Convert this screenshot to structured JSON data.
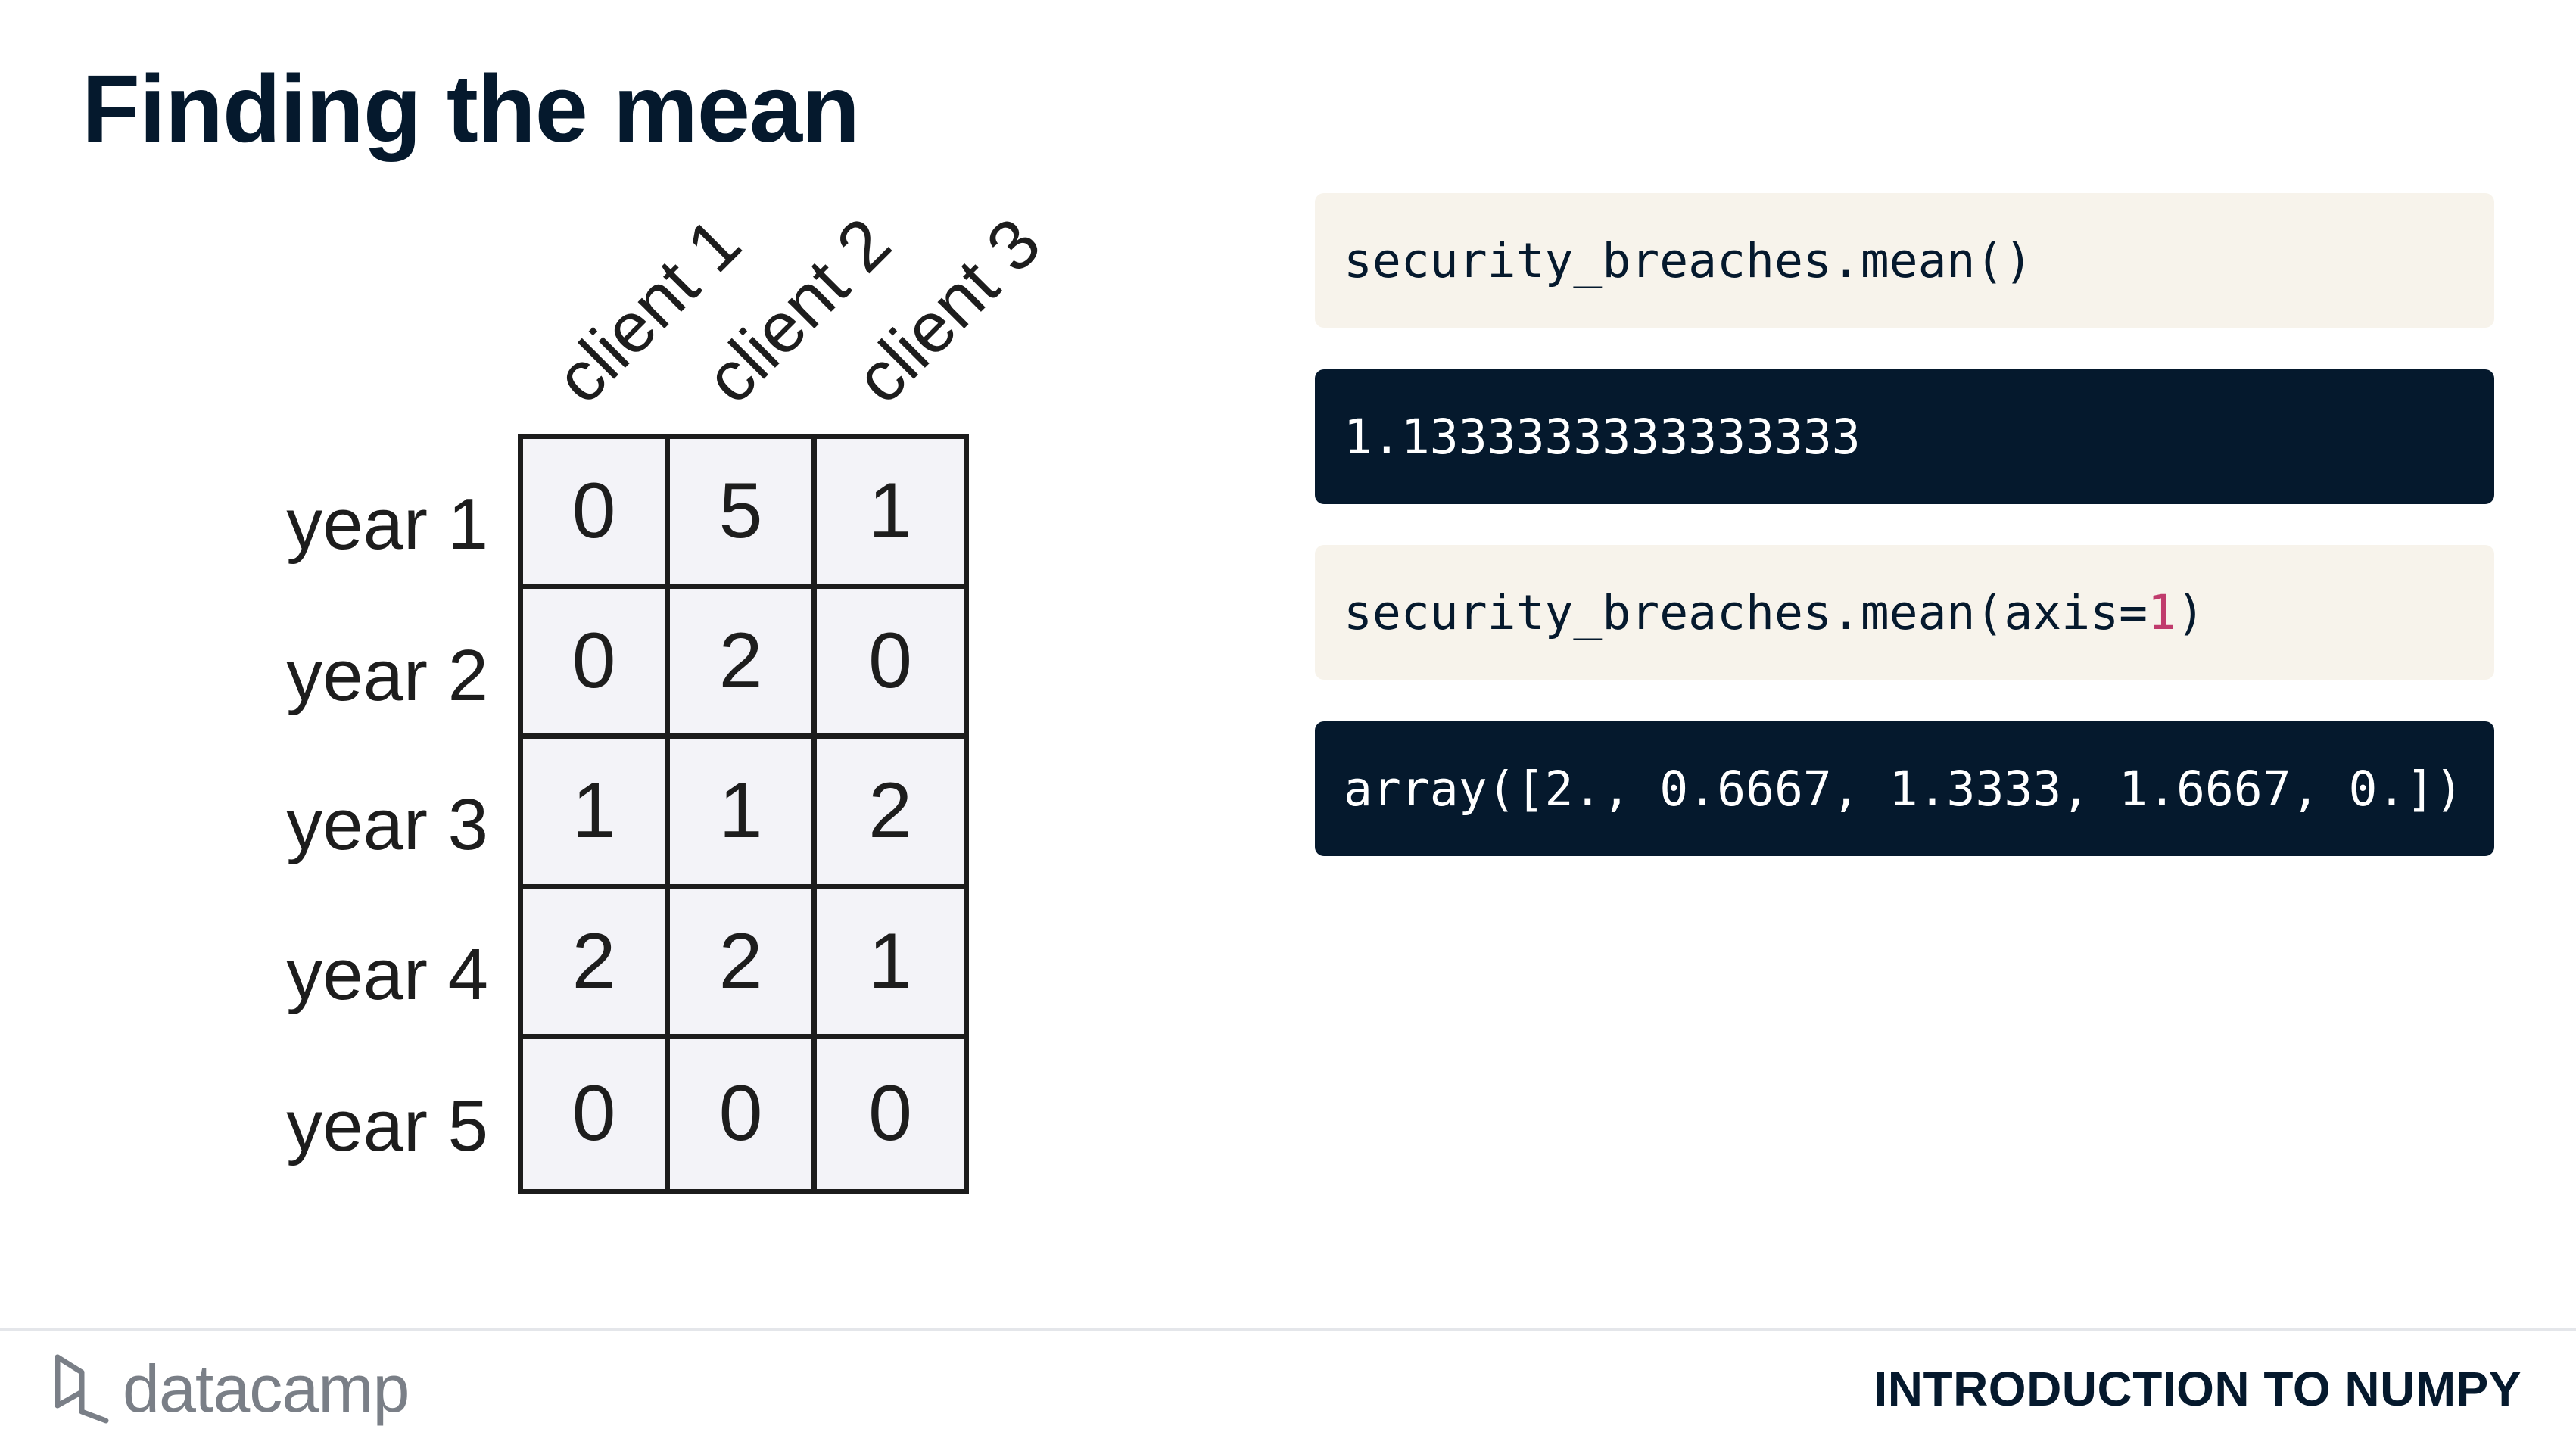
{
  "slide": {
    "title": "Finding the mean",
    "course": "INTRODUCTION TO NUMPY",
    "brand": "datacamp"
  },
  "diagram": {
    "column_labels": [
      "client 1",
      "client 2",
      "client 3"
    ],
    "row_labels": [
      "year 1",
      "year 2",
      "year 3",
      "year 4",
      "year 5"
    ],
    "values": [
      [
        "0",
        "5",
        "1"
      ],
      [
        "0",
        "2",
        "0"
      ],
      [
        "1",
        "1",
        "2"
      ],
      [
        "2",
        "2",
        "1"
      ],
      [
        "0",
        "0",
        "0"
      ]
    ]
  },
  "code": {
    "block1": "security_breaches.mean()",
    "output1": "1.1333333333333333",
    "block2_prefix": "security_breaches.mean(axis=",
    "block2_number": "1",
    "block2_suffix": ")",
    "output2": "array([2., 0.6667, 1.3333, 1.6667, 0.])"
  },
  "colors": {
    "navy": "#05192d",
    "code_input_bg": "#f7f3eb",
    "number_highlight": "#c03b6c"
  },
  "icons": {
    "logo": "datacamp-logo-icon"
  }
}
